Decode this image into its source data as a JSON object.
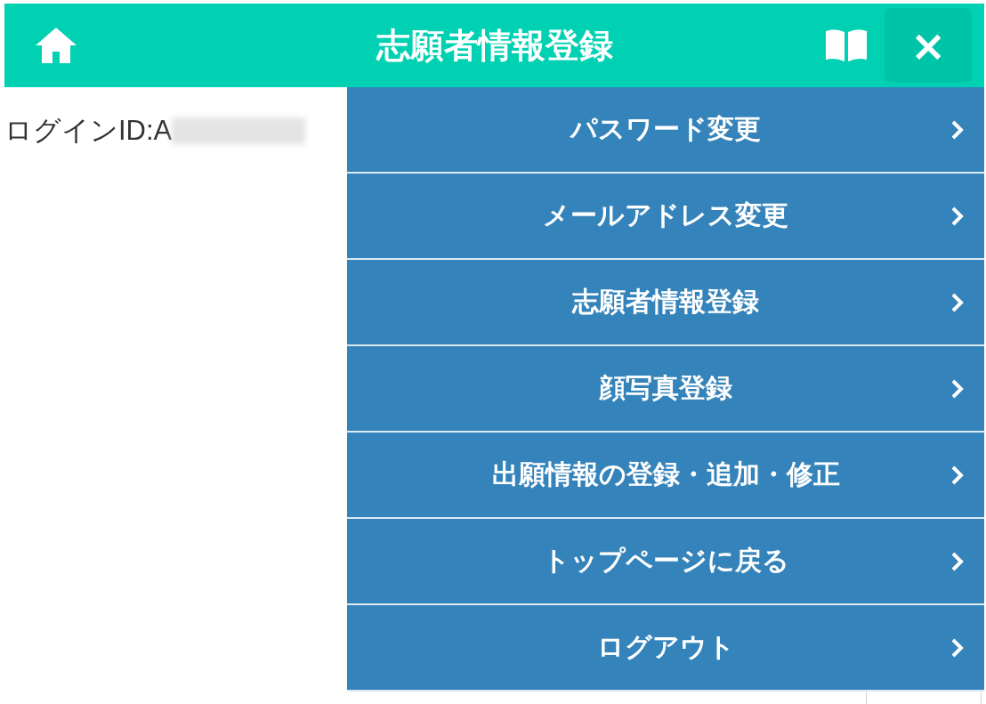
{
  "header": {
    "title": "志願者情報登録",
    "close_label": "×"
  },
  "login_id": "ログインID:A",
  "menu": [
    {
      "label": "パスワード変更"
    },
    {
      "label": "メールアドレス変更"
    },
    {
      "label": "志願者情報登録"
    },
    {
      "label": "顔写真登録"
    },
    {
      "label": "出願情報の登録・追加・修正"
    },
    {
      "label": "トップページに戻る"
    },
    {
      "label": "ログアウト"
    }
  ]
}
